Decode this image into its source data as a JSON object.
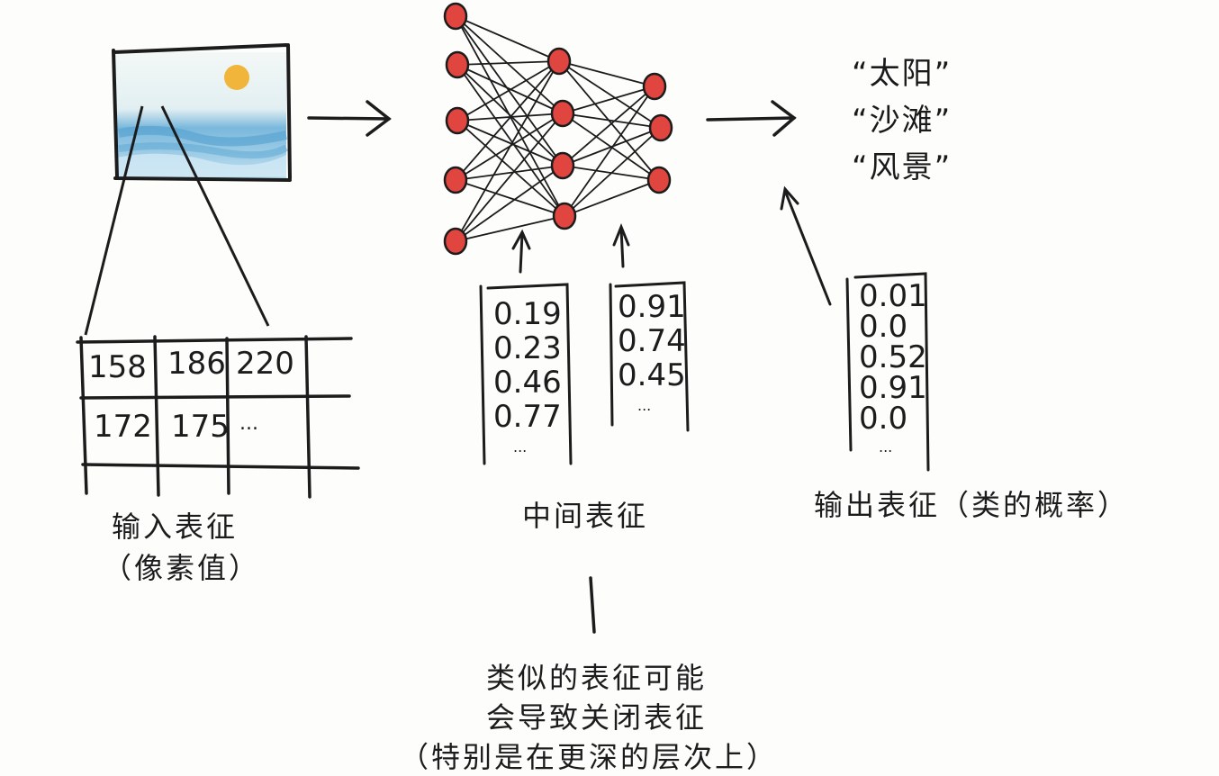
{
  "input": {
    "grid_row1": [
      "158",
      "186",
      "220"
    ],
    "grid_row2": [
      "172",
      "175",
      "..."
    ],
    "caption_line1": "输入表征",
    "caption_line2": "（像素值）"
  },
  "intermediate": {
    "vector1": [
      "0.19",
      "0.23",
      "0.46",
      "0.77",
      "..."
    ],
    "vector2": [
      "0.91",
      "0.74",
      "0.45",
      "..."
    ],
    "caption": "中间表征"
  },
  "output": {
    "labels": [
      "“太阳”",
      "“沙滩”",
      "“风景”"
    ],
    "vector": [
      "0.01",
      "0.0",
      "0.52",
      "0.91",
      "0.0",
      "..."
    ],
    "caption": "输出表征（类的概率）"
  },
  "note": {
    "line1": "类似的表征可能",
    "line2": "会导致关闭表征",
    "line3": "（特别是在更深的层次上）"
  },
  "colors": {
    "neuron": "#e0453f",
    "sky": "#d8ebf3",
    "water": "#5aa6d2",
    "sun": "#f0b53a",
    "ink": "#1c1c1c"
  }
}
